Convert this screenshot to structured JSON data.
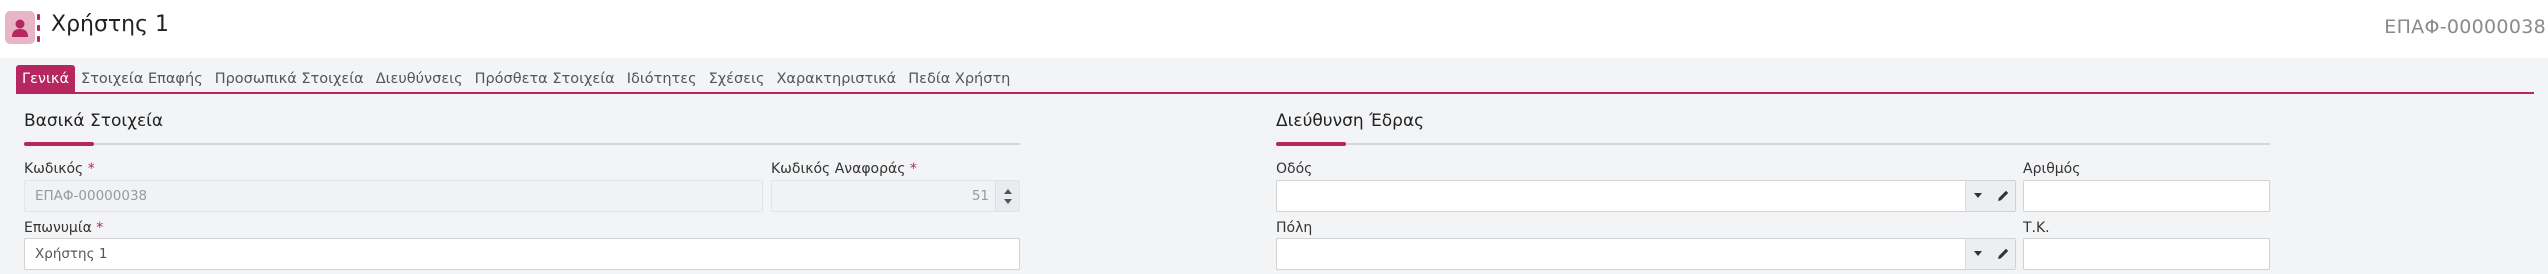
{
  "header": {
    "title": "Χρήστης 1",
    "record_code": "ΕΠΑΦ-00000038",
    "avatar_icon": "user-icon",
    "menu_icon": "kebab-menu-icon"
  },
  "tabs": [
    {
      "label": "Γενικά",
      "active": true
    },
    {
      "label": "Στοιχεία Επαφής",
      "active": false
    },
    {
      "label": "Προσωπικά Στοιχεία",
      "active": false
    },
    {
      "label": "Διευθύνσεις",
      "active": false
    },
    {
      "label": "Πρόσθετα Στοιχεία",
      "active": false
    },
    {
      "label": "Ιδιότητες",
      "active": false
    },
    {
      "label": "Σχέσεις",
      "active": false
    },
    {
      "label": "Χαρακτηριστικά",
      "active": false
    },
    {
      "label": "Πεδία Χρήστη",
      "active": false
    }
  ],
  "basic": {
    "title": "Βασικά Στοιχεία",
    "code_label": "Κωδικός",
    "code_value": "ΕΠΑΦ-00000038",
    "ref_code_label": "Κωδικός Αναφοράς",
    "ref_code_value": "51",
    "name_label": "Επωνυμία",
    "name_value": "Χρήστης 1",
    "required_mark": "*"
  },
  "address": {
    "title": "Διεύθυνση Έδρας",
    "street_label": "Οδός",
    "street_value": "",
    "number_label": "Αριθμός",
    "number_value": "",
    "city_label": "Πόλη",
    "city_value": "",
    "zip_label": "Τ.Κ.",
    "zip_value": ""
  },
  "colors": {
    "accent": "#b62660",
    "avatar_bg": "#e8b4c8",
    "page_bg": "#f3f4f6"
  }
}
